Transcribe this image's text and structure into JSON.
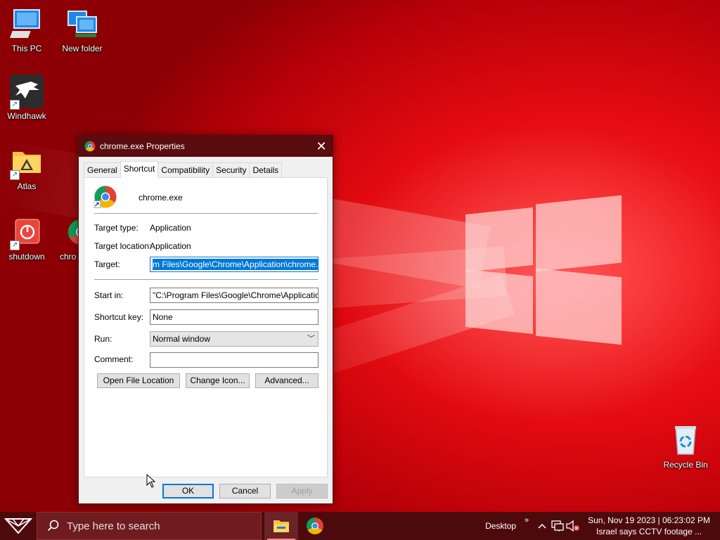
{
  "desktop": {
    "icons": [
      {
        "label": "This PC"
      },
      {
        "label": "New folder"
      },
      {
        "label": "Windhawk"
      },
      {
        "label": "Atlas"
      },
      {
        "label": "shutdown"
      },
      {
        "label": "chro"
      },
      {
        "label": "Recycle Bin"
      }
    ]
  },
  "dialog": {
    "title": "chrome.exe Properties",
    "tabs": [
      {
        "label": "General",
        "active": false
      },
      {
        "label": "Shortcut",
        "active": true
      },
      {
        "label": "Compatibility",
        "active": false
      },
      {
        "label": "Security",
        "active": false
      },
      {
        "label": "Details",
        "active": false
      }
    ],
    "shortcut_name": "chrome.exe",
    "target_type_label": "Target type:",
    "target_type_value": "Application",
    "target_location_label": "Target location:",
    "target_location_value": "Application",
    "target_label": "Target:",
    "target_value": "m Files\\Google\\Chrome\\Application\\chrome.exe\"",
    "start_in_label": "Start in:",
    "start_in_value": "\"C:\\Program Files\\Google\\Chrome\\Application\"",
    "shortcut_key_label": "Shortcut key:",
    "shortcut_key_value": "None",
    "run_label": "Run:",
    "run_value": "Normal window",
    "comment_label": "Comment:",
    "comment_value": "",
    "open_file_location_label": "Open File Location",
    "change_icon_label": "Change Icon...",
    "advanced_label": "Advanced...",
    "ok_label": "OK",
    "cancel_label": "Cancel",
    "apply_label": "Apply"
  },
  "taskbar": {
    "search_placeholder": "Type here to search",
    "desktop_label": "Desktop",
    "clock_line1": "Sun, Nov 19 2023 | 06:23:02 PM",
    "clock_line2": "Israel says CCTV footage ..."
  },
  "colors": {
    "accent": "#0078d7",
    "titlebar": "#5a0c0f",
    "taskbar": "#4d0a0d",
    "wallpaper": "#e30b10"
  }
}
